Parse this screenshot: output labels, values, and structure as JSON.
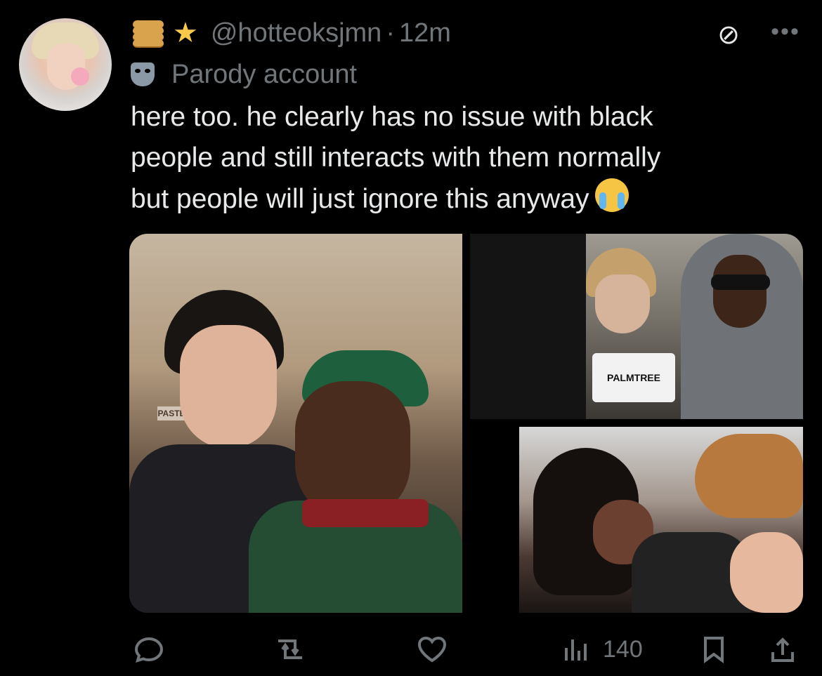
{
  "post": {
    "author": {
      "avatar_icon": "profile-photo",
      "emoji_prefix": [
        "pancake",
        "glowing-star"
      ],
      "handle": "@hotteoksjmn",
      "separator": "·",
      "time": "12m",
      "badge_icon": "performing-arts-mask",
      "badge_label": "Parody account"
    },
    "text": "here too. he clearly has no issue with black\npeople and still interacts with them normally\nbut people will just ignore this anyway",
    "text_emoji": "loudly-crying-face",
    "media": {
      "count": 3,
      "sign_text": "PALMTREE",
      "shop_sign": "PASTE"
    },
    "actions": {
      "reply_icon": "reply-icon",
      "repost_icon": "repost-icon",
      "like_icon": "heart-icon",
      "views_icon": "views-bar-icon",
      "views_count": "140",
      "bookmark_icon": "bookmark-icon",
      "share_icon": "share-icon"
    },
    "toolbar": {
      "mute_icon": "mute-icon",
      "more_icon": "more-icon"
    },
    "colors": {
      "background": "#000000",
      "text_primary": "#e7e9ea",
      "text_secondary": "#71767b"
    }
  }
}
